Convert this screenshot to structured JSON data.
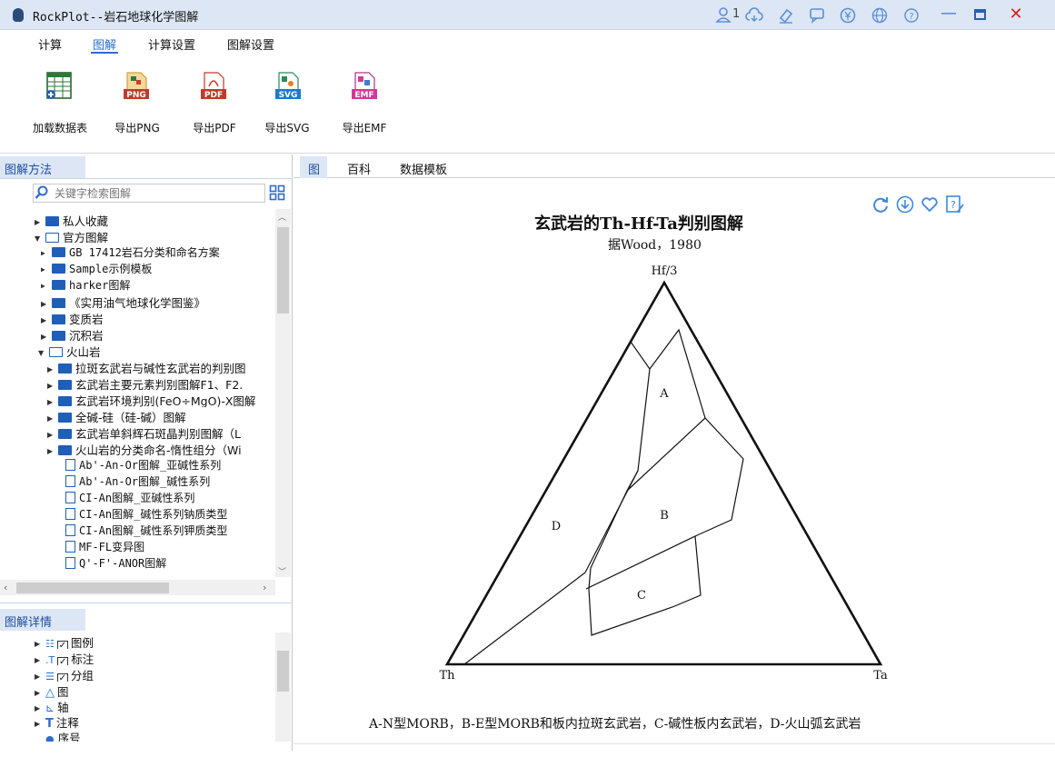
{
  "window": {
    "title": "RockPlot--岩石地球化学图解",
    "user_count": "1"
  },
  "menu": {
    "items": [
      "计算",
      "图解",
      "计算设置",
      "图解设置"
    ]
  },
  "ribbon": {
    "buttons": [
      {
        "label": "加载数据表",
        "icon": "load-table-icon"
      },
      {
        "label": "导出PNG",
        "icon": "png-file-icon",
        "badge": "PNG"
      },
      {
        "label": "导出PDF",
        "icon": "pdf-file-icon",
        "badge": "PDF"
      },
      {
        "label": "导出SVG",
        "icon": "svg-file-icon",
        "badge": "SVG"
      },
      {
        "label": "导出EMF",
        "icon": "emf-file-icon",
        "badge": "EMF"
      }
    ]
  },
  "left_panel": {
    "header": "图解方法",
    "search_placeholder": "关键字检索图解",
    "tree": [
      {
        "label": "私人收藏",
        "level": 0,
        "type": "folder",
        "expanded": false
      },
      {
        "label": "官方图解",
        "level": 0,
        "type": "folder",
        "expanded": true
      },
      {
        "label": "GB 17412岩石分类和命名方案",
        "level": 1,
        "type": "folder",
        "expanded": false
      },
      {
        "label": "Sample示例模板",
        "level": 1,
        "type": "folder",
        "expanded": false
      },
      {
        "label": "harker图解",
        "level": 1,
        "type": "folder",
        "expanded": false
      },
      {
        "label": "《实用油气地球化学图鉴》",
        "level": 1,
        "type": "folder",
        "expanded": false
      },
      {
        "label": "变质岩",
        "level": 1,
        "type": "folder",
        "expanded": false
      },
      {
        "label": "沉积岩",
        "level": 1,
        "type": "folder",
        "expanded": false
      },
      {
        "label": "火山岩",
        "level": 1,
        "type": "folder",
        "expanded": true
      },
      {
        "label": "拉斑玄武岩与碱性玄武岩的判别图",
        "level": 2,
        "type": "folder",
        "expanded": false
      },
      {
        "label": "玄武岩主要元素判别图解F1、F2.",
        "level": 2,
        "type": "folder",
        "expanded": false
      },
      {
        "label": "玄武岩环境判别(FeO÷MgO)-X图解",
        "level": 2,
        "type": "folder",
        "expanded": false
      },
      {
        "label": "全碱-硅（硅-碱）图解",
        "level": 2,
        "type": "folder",
        "expanded": false
      },
      {
        "label": "玄武岩单斜辉石斑晶判别图解（L",
        "level": 2,
        "type": "folder",
        "expanded": false
      },
      {
        "label": "火山岩的分类命名-惰性组分（Wi",
        "level": 2,
        "type": "folder",
        "expanded": false
      },
      {
        "label": "Ab'-An-Or图解_亚碱性系列",
        "level": 2,
        "type": "doc"
      },
      {
        "label": "Ab'-An-Or图解_碱性系列",
        "level": 2,
        "type": "doc"
      },
      {
        "label": "CI-An图解_亚碱性系列",
        "level": 2,
        "type": "doc"
      },
      {
        "label": "CI-An图解_碱性系列钠质类型",
        "level": 2,
        "type": "doc"
      },
      {
        "label": "CI-An图解_碱性系列钾质类型",
        "level": 2,
        "type": "doc"
      },
      {
        "label": "MF-FL变异图",
        "level": 2,
        "type": "doc"
      },
      {
        "label": "Q'-F'-ANOR图解",
        "level": 2,
        "type": "doc"
      }
    ]
  },
  "detail_panel": {
    "header": "图解详情",
    "items": [
      {
        "label": "图例",
        "checked": true,
        "icon": "legend-icon"
      },
      {
        "label": "标注",
        "checked": true,
        "icon": "annotation-icon"
      },
      {
        "label": "分组",
        "checked": true,
        "icon": "group-icon"
      },
      {
        "label": "图",
        "icon": "triangle-icon"
      },
      {
        "label": "轴",
        "icon": "axis-icon"
      },
      {
        "label": "注释",
        "icon": "text-icon"
      },
      {
        "label": "序号",
        "icon": "dot-icon"
      }
    ]
  },
  "right_panel": {
    "tabs": [
      "图",
      "百科",
      "数据模板"
    ],
    "active_tab": "图"
  },
  "chart_data": {
    "type": "ternary",
    "title": "玄武岩的Th-Hf-Ta判别图解",
    "subtitle": "据Wood，1980",
    "vertices": {
      "top": "Hf/3",
      "left": "Th",
      "right": "Ta"
    },
    "fields": [
      {
        "label": "A"
      },
      {
        "label": "B"
      },
      {
        "label": "C"
      },
      {
        "label": "D"
      }
    ],
    "caption": "A-N型MORB，B-E型MORB和板内拉斑玄武岩，C-碱性板内玄武岩，D-火山弧玄武岩"
  },
  "colors": {
    "accent": "#2b6cd0",
    "titlebar_bg": "#dce6f4",
    "close": "#d62020"
  }
}
